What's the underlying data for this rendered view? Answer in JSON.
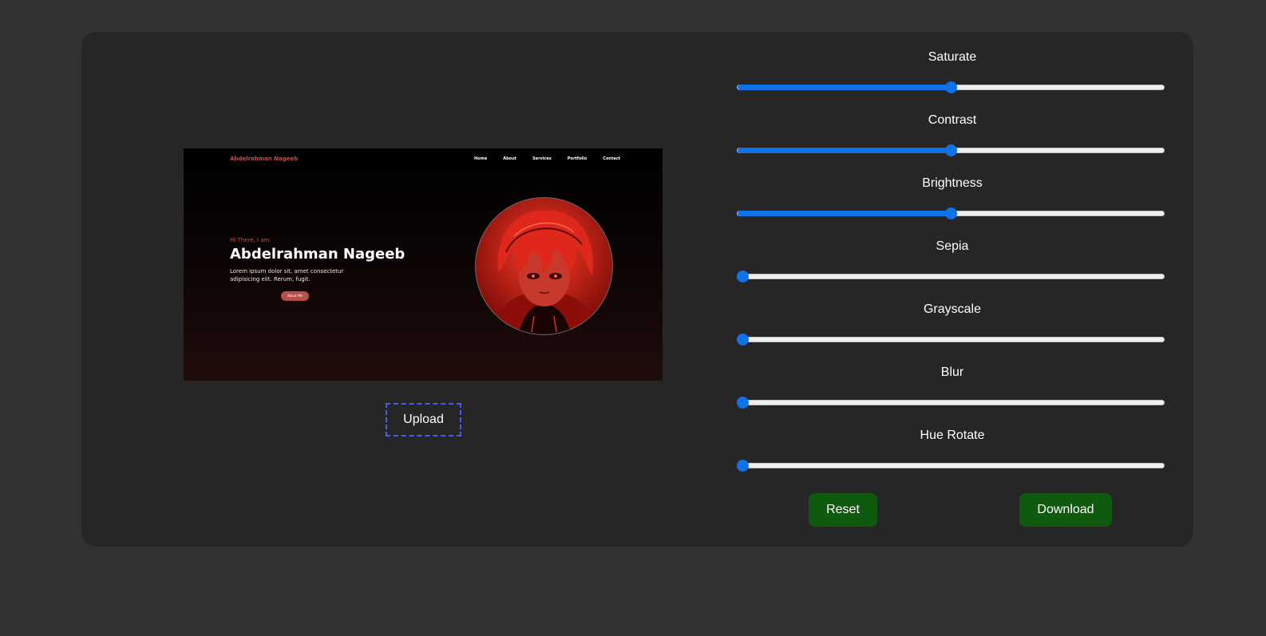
{
  "preview": {
    "brand": "Abdelrahman Nageeb",
    "nav": [
      "Home",
      "About",
      "Services",
      "Portfolio",
      "Contact"
    ],
    "greeting": "Hi There, I am",
    "name": "Abdelrahman Nageeb",
    "description": "Lorem ipsum dolor sit, amet consectetur adipisicing elit. Rerum, fugit.",
    "button_label": "About Me",
    "accent_color": "#c0504d",
    "avatar_icon": "anime-portrait-icon"
  },
  "upload": {
    "label": "Upload"
  },
  "controls": {
    "saturate": {
      "label": "Saturate",
      "value": 100,
      "max": 200
    },
    "contrast": {
      "label": "Contrast",
      "value": 100,
      "max": 200
    },
    "brightness": {
      "label": "Brightness",
      "value": 100,
      "max": 200
    },
    "sepia": {
      "label": "Sepia",
      "value": 0,
      "max": 100
    },
    "grayscale": {
      "label": "Grayscale",
      "value": 0,
      "max": 100
    },
    "blur": {
      "label": "Blur",
      "value": 0,
      "max": 100
    },
    "hue_rotate": {
      "label": "Hue Rotate",
      "value": 0,
      "max": 360
    }
  },
  "actions": {
    "reset_label": "Reset",
    "download_label": "Download"
  },
  "colors": {
    "page_bg": "#323232",
    "card_bg": "#262626",
    "slider_accent": "#0f72e6",
    "button_bg": "#0f5a0f",
    "upload_border": "#4a5bf0"
  }
}
